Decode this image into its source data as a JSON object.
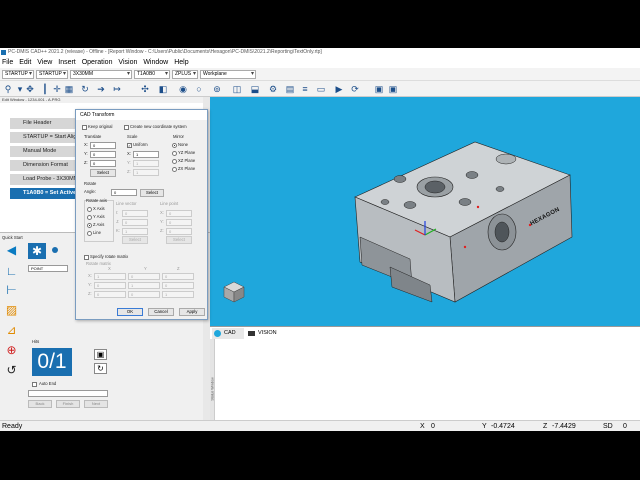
{
  "window": {
    "title": "PC-DMIS CAD++ 2021.2 (release) - Offline - [Report Window - C:\\Users\\Public\\Documents\\Hexagon\\PC-DMIS\\2021.2\\Reporting\\TextOnly.rtp]"
  },
  "menu": [
    "File",
    "Edit",
    "View",
    "Insert",
    "Operation",
    "Vision",
    "Window",
    "Help"
  ],
  "toolbar": {
    "combo1": "STARTUP",
    "combo2": "STARTUP",
    "combo3": "3X30MM",
    "combo4": "T1A0B0",
    "combo5": "ZPLUS",
    "combo6": "Workplane"
  },
  "edit_window": {
    "title": "Edit Window - 1234-001 - A.PRG",
    "items": [
      {
        "label": "File Header"
      },
      {
        "label": "STARTUP = Start Alig"
      },
      {
        "label": "Manual Mode"
      },
      {
        "label": "Dimension Format"
      },
      {
        "label": "Load Probe - 3X30MM"
      },
      {
        "label": "T1A0B0 = Set Active"
      }
    ]
  },
  "quick_start": {
    "title": "Quick Start",
    "field_value": "POINT",
    "hits_label": "Hits",
    "counter": "0/1",
    "auto_end": "Auto End",
    "buttons": {
      "back": "Back",
      "finish": "Finish",
      "next": "Next"
    }
  },
  "dialog": {
    "title": "CAD Transform",
    "keep_original": "Keep original",
    "create_new_csys": "Create new coordinate system",
    "translate": {
      "title": "Translate",
      "x_label": "X:",
      "x": "0",
      "y_label": "Y:",
      "y": "0",
      "z_label": "Z:",
      "z": "0",
      "select": "Select"
    },
    "scale": {
      "title": "Scale",
      "uniform": "Uniform",
      "x_label": "X:",
      "x": "1",
      "y_label": "Y:",
      "y": "1",
      "z_label": "Z:",
      "z": "1"
    },
    "mirror": {
      "title": "Mirror",
      "options": [
        "None",
        "YZ Plane",
        "XZ Plane",
        "ZX Plane"
      ],
      "selected": "None"
    },
    "rotate": {
      "title": "Rotate",
      "angle_label": "Angle:",
      "angle": "0",
      "select": "Select",
      "axis_title": "Rotate axis",
      "axis_options": [
        "X Axis",
        "Y Axis",
        "Z Axis",
        "Line"
      ],
      "axis_selected": "Z Axis",
      "line_vector_title": "Line vector",
      "line_point_title": "Line point",
      "lv": {
        "i_label": "I:",
        "i": "0",
        "j_label": "J:",
        "j": "0",
        "k_label": "K:",
        "k": "1"
      },
      "lp": {
        "x_label": "X:",
        "x": "0",
        "y_label": "Y:",
        "y": "0",
        "z_label": "Z:",
        "z": "0"
      }
    },
    "matrix": {
      "specify": "Specify rotate matrix",
      "title": "Rotate matrix",
      "col_x": "X",
      "col_y": "Y",
      "col_z": "Z",
      "rows": [
        {
          "label": "X:",
          "values": [
            "1",
            "0",
            "0"
          ]
        },
        {
          "label": "Y:",
          "values": [
            "0",
            "1",
            "0"
          ]
        },
        {
          "label": "Z:",
          "values": [
            "0",
            "0",
            "1"
          ]
        }
      ]
    },
    "ok": "OK",
    "cancel": "Cancel",
    "apply": "Apply"
  },
  "viewport": {
    "tabs": [
      {
        "label": "CAD"
      },
      {
        "label": "VISION"
      }
    ],
    "part_logo": "HEXAGON",
    "status_window_label": "Status Window"
  },
  "status": {
    "ready": "Ready",
    "x_label": "X",
    "x": "0",
    "y_label": "Y",
    "y": "-0.4724",
    "z_label": "Z",
    "z": "-7.4429",
    "sd_label": "SD",
    "sd": "0"
  },
  "colors": {
    "accent": "#1a6fb0",
    "viewport": "#1fa7dc",
    "axis_x": "#e02020",
    "axis_y": "#20b020",
    "axis_z": "#2040e0"
  }
}
